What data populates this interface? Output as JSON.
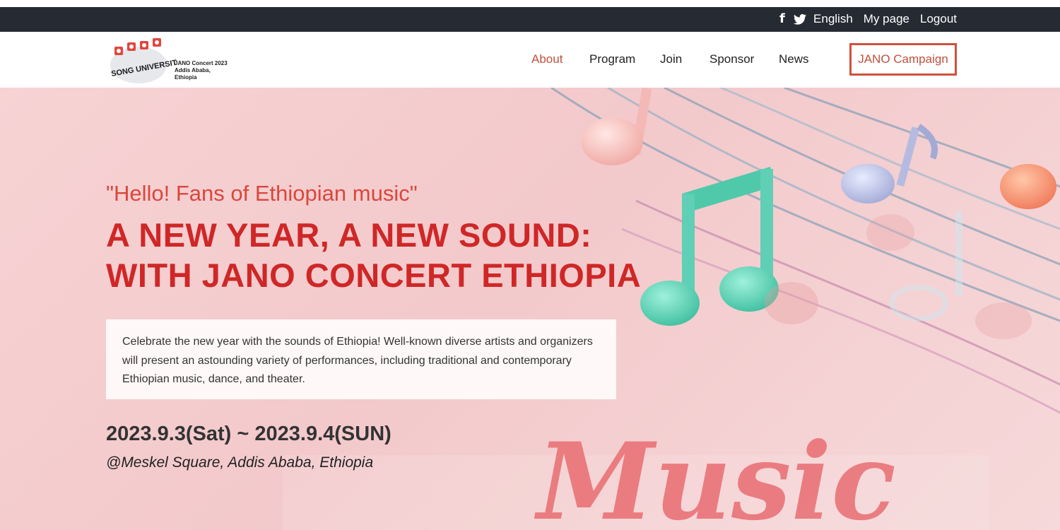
{
  "topbar": {
    "facebook_icon": "facebook-icon",
    "twitter_icon": "twitter-icon",
    "language": "English",
    "mypage": "My page",
    "logout": "Logout"
  },
  "logo": {
    "text": "SONG UNIVERSITY",
    "subtitle_line1": "JANO Concert 2023",
    "subtitle_line2": "Addis Ababa, Ethiopia"
  },
  "nav": {
    "items": [
      "About",
      "Program",
      "Join",
      "Sponsor",
      "News"
    ],
    "active": "About",
    "campaign": "JANO Campaign"
  },
  "hero": {
    "greeting": "\"Hello! Fans of Ethiopian music\"",
    "headline": "A NEW YEAR, A NEW SOUND: WITH JANO CONCERT ETHIOPIA",
    "description": "Celebrate the new year with the sounds of Ethiopia! Well-known diverse artists and organizers will present an astounding variety of performances, including traditional and contemporary Ethiopian music, dance, and theater.",
    "dates": "2023.9.3(Sat) ~ 2023.9.4(SUN)",
    "venue": "@Meskel Square, Addis Ababa, Ethiopia",
    "art_word": "Music"
  },
  "colors": {
    "accent": "#c0503c",
    "headline": "#cf2727",
    "topbar": "#262a33",
    "hero_bg": "#f3c9cb",
    "note_teal": "#5fcfb5"
  }
}
